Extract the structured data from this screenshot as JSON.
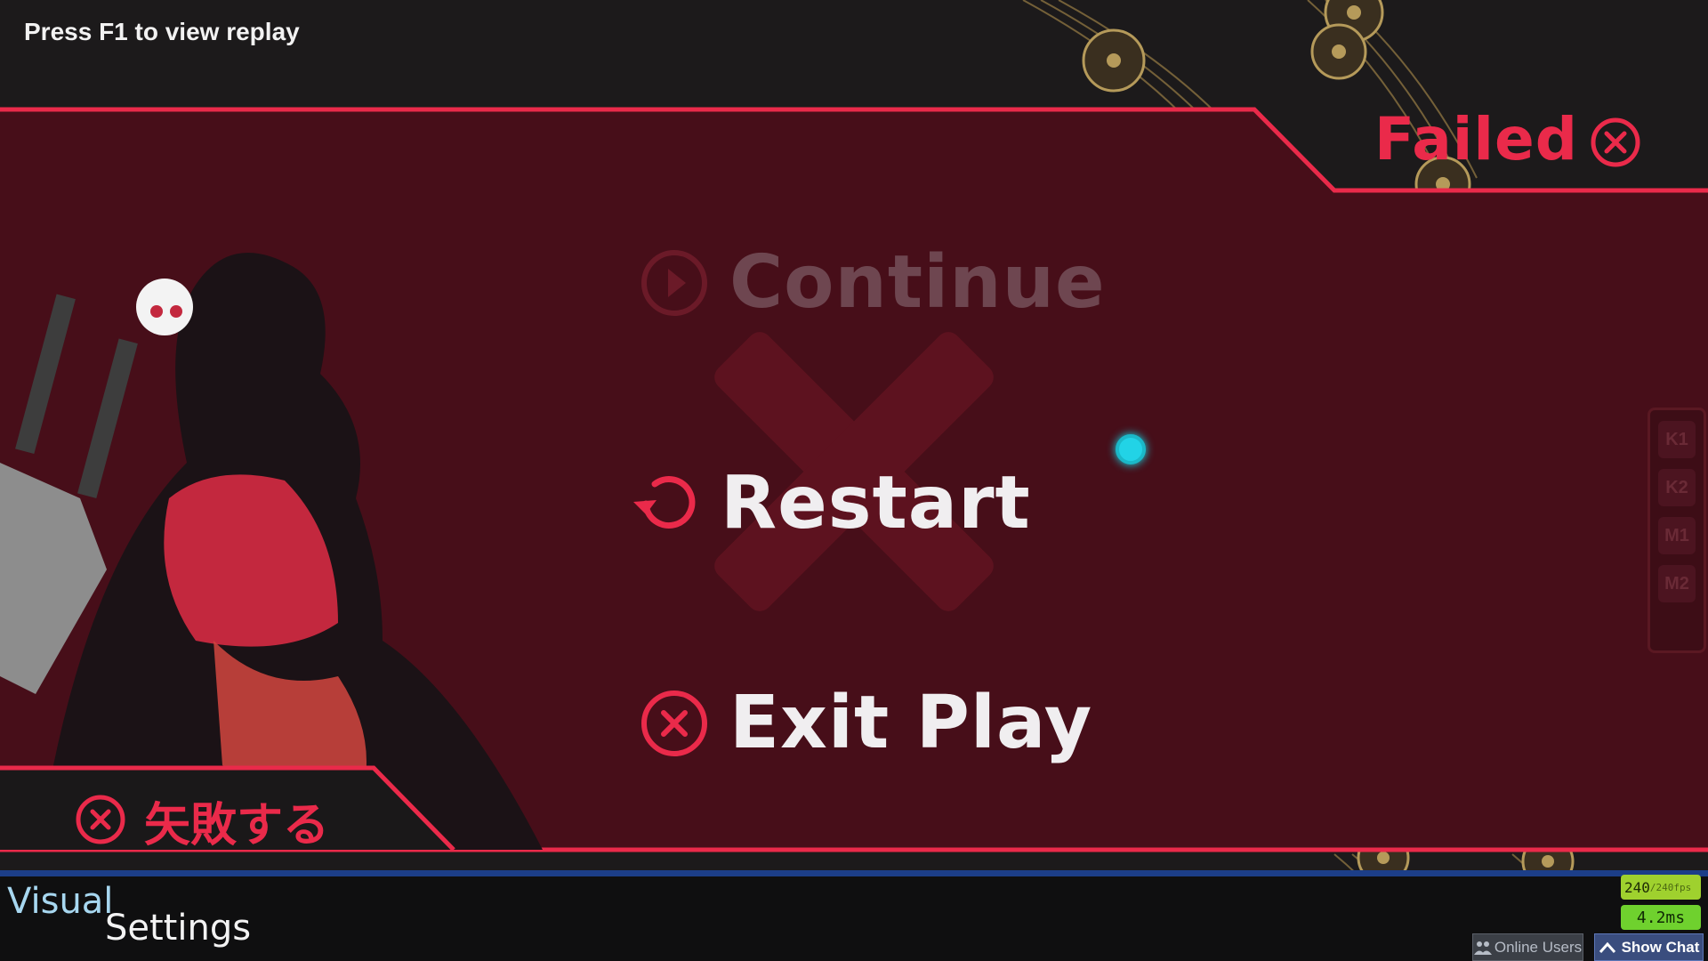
{
  "hint": "Press F1 to view replay",
  "header": {
    "status": "Failed"
  },
  "menu": {
    "continue": "Continue",
    "restart": "Restart",
    "exit": "Exit Play"
  },
  "footer_jp": "矢敗する",
  "keys": [
    "K1",
    "K2",
    "M1",
    "M2"
  ],
  "settings": {
    "visual": "Visual",
    "settings": "Settings"
  },
  "perf": {
    "fps": "240",
    "fps_max": "/240fps",
    "frametime": "4.2ms"
  },
  "buttons": {
    "online_users": "Online Users",
    "show_chat": "Show Chat"
  },
  "colors": {
    "accent": "#ea2a4a",
    "panel": "#470e19",
    "cursor": "#22d3e6"
  }
}
